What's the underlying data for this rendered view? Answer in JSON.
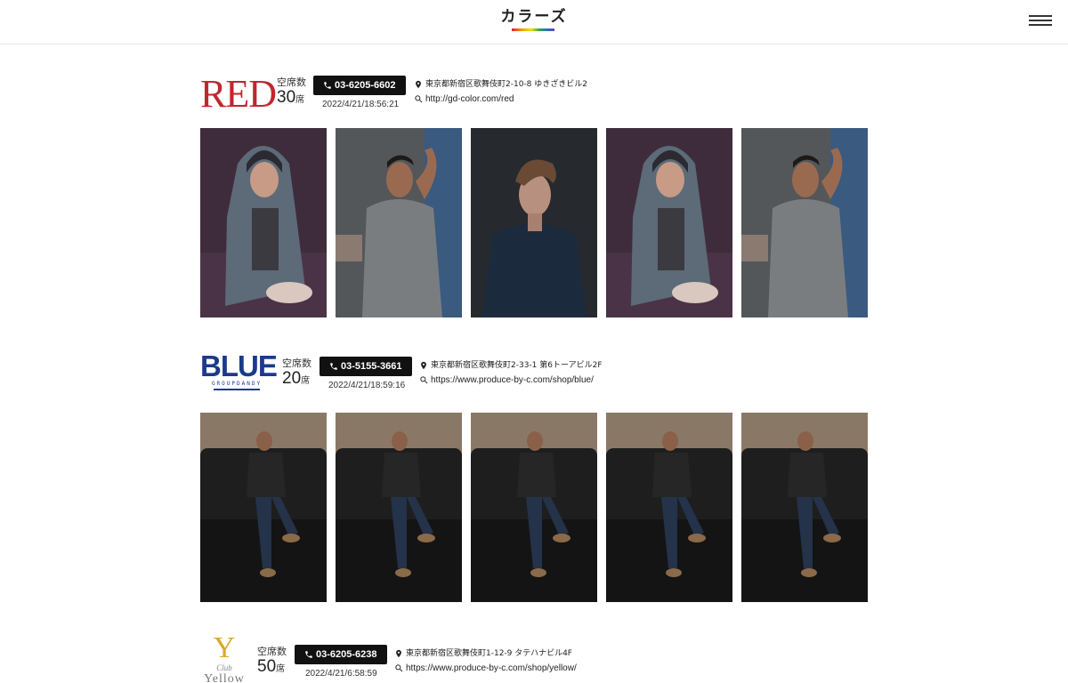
{
  "header": {
    "logo_text": "カラーズ",
    "menu_icon": "hamburger-menu-icon"
  },
  "colors": {
    "red_brand": "#c0272d",
    "blue_brand": "#1b3a8a",
    "yellow_brand": "#d9a928",
    "button_bg": "#111111"
  },
  "shops": [
    {
      "brand": "RED",
      "seats_label": "空席数",
      "seats": "30",
      "seats_unit": "席",
      "tel": "03-6205-6602",
      "updated": "2022/4/21/18:56:21",
      "address": "東京都新宿区歌舞伎町2-10-8 ゆきざきビル2",
      "url": "http://gd-color.com/red"
    },
    {
      "brand": "BLUE",
      "brand_sub": "GROUPDANDY",
      "seats_label": "空席数",
      "seats": "20",
      "seats_unit": "席",
      "tel": "03-5155-3661",
      "updated": "2022/4/21/18:59:16",
      "address": "東京都新宿区歌舞伎町2-33-1 第6トーアビル2F",
      "url": "https://www.produce-by-c.com/shop/blue/"
    },
    {
      "brand": "Y",
      "brand_club": "Club",
      "brand_name": "Yellow",
      "seats_label": "空席数",
      "seats": "50",
      "seats_unit": "席",
      "tel": "03-6205-6238",
      "updated": "2022/4/21/6:58:59",
      "address": "東京都新宿区歌舞伎町1-12-9 タテハナビル4F",
      "url": "https://www.produce-by-c.com/shop/yellow/"
    }
  ]
}
